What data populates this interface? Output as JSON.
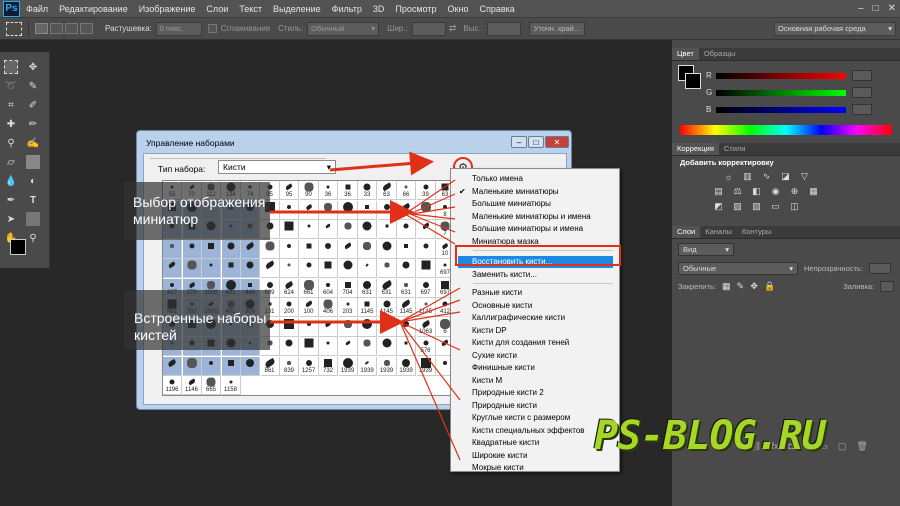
{
  "app": {
    "logo": "Ps",
    "menu": [
      "Файл",
      "Редактирование",
      "Изображение",
      "Слои",
      "Текст",
      "Выделение",
      "Фильтр",
      "3D",
      "Просмотр",
      "Окно",
      "Справка"
    ],
    "window_controls": [
      "–",
      "□",
      "✕"
    ]
  },
  "options_bar": {
    "feather_label": "Растушевка:",
    "feather_value": "0 пикс.",
    "antialias_label": "Сглаживание",
    "style_label": "Стиль:",
    "style_value": "Обычный",
    "width_label": "Шир.:",
    "height_label": "Выс.:",
    "refine_button": "Уточн. край...",
    "workspace": "Основная рабочая среда"
  },
  "color_panel": {
    "tabs": [
      "Цвет",
      "Образцы"
    ],
    "channels": [
      "R",
      "G",
      "B"
    ],
    "channel_values": [
      0,
      0,
      0
    ]
  },
  "adjustments_panel": {
    "tabs": [
      "Коррекция",
      "Стили"
    ],
    "title": "Добавить корректировку"
  },
  "layers_panel": {
    "tabs": [
      "Слои",
      "Каналы",
      "Контуры"
    ],
    "kind_label": "Вид",
    "blend_mode": "Обычные",
    "opacity_label": "Непрозрачность:",
    "lock_label": "Закрепить:",
    "fill_label": "Заливка:"
  },
  "dialog": {
    "title": "Управление наборами",
    "preset_type_label": "Тип набора:",
    "preset_type_value": "Кисти",
    "gear_icon": "⚙",
    "brush_numbers": [
      [
        "55",
        "70",
        "112",
        "134",
        "74",
        "95",
        "95",
        "90",
        "36",
        "36",
        "33",
        "63",
        "66",
        "39",
        "63"
      ],
      [
        "",
        "",
        "",
        "",
        "",
        "",
        "",
        "",
        "",
        "",
        "",
        "",
        "",
        "",
        "8"
      ],
      [
        "",
        "",
        "",
        "",
        "",
        "",
        "",
        "",
        "",
        "",
        "",
        "",
        "",
        "",
        "7"
      ],
      [
        "",
        "",
        "",
        "",
        "",
        "",
        "",
        "",
        "",
        "",
        "",
        "",
        "",
        "",
        "10"
      ],
      [
        "",
        "",
        "",
        "",
        "",
        "",
        "",
        "",
        "",
        "",
        "",
        "",
        "",
        "",
        "697"
      ],
      [
        "427",
        "279",
        "1000",
        "401",
        "448",
        "689",
        "624",
        "661",
        "604",
        "704",
        "631",
        "631",
        "631",
        "697",
        "697"
      ],
      [
        "491",
        "792",
        "1000",
        "401",
        "300",
        "131",
        "200",
        "100",
        "406",
        "203",
        "1145",
        "1145",
        "1145",
        "1145",
        "412"
      ],
      [
        "",
        "",
        "",
        "",
        "",
        "",
        "",
        "",
        "",
        "",
        "",
        "",
        "",
        "1063",
        "6"
      ],
      [
        "",
        "",
        "",
        "",
        "",
        "",
        "",
        "",
        "",
        "",
        "",
        "",
        "",
        "576",
        ""
      ],
      [
        "",
        "",
        "",
        "",
        "",
        "861",
        "839",
        "1257",
        "732",
        "1939",
        "1939",
        "1939",
        "1939",
        "1939",
        ""
      ],
      [
        "1196",
        "1146",
        "665",
        "1158",
        "",
        "",
        "",
        "",
        "",
        "",
        "",
        "",
        "",
        "",
        ""
      ]
    ],
    "partial_row_top": [
      "",
      "",
      "",
      "",
      "",
      "",
      "",
      "",
      "",
      "",
      "",
      "",
      "",
      "",
      ""
    ]
  },
  "flyout_menu": {
    "view_items": [
      "Только имена",
      "Маленькие миниатюры",
      "Большие миниатюры",
      "Маленькие миниатюры и имена",
      "Большие миниатюры и имена",
      "Миниатюра мазка"
    ],
    "checked_index": 1,
    "action_items": [
      "Восстановить кисти...",
      "Заменить кисти..."
    ],
    "highlighted": "Восстановить кисти...",
    "library_items": [
      "Разные кисти",
      "Основные кисти",
      "Каллиграфические кисти",
      "Кисти DP",
      "Кисти для создания теней",
      "Сухие кисти",
      "Финишные кисти",
      "Кисти М",
      "Природные кисти 2",
      "Природные кисти",
      "Круглые кисти с размером",
      "Кисти специальных эффектов",
      "Квадратные кисти",
      "Широкие кисти",
      "Мокрые кисти"
    ]
  },
  "annotations": {
    "thumbnail_choice": [
      "Выбор отображения",
      "миниатюр"
    ],
    "builtin_sets": [
      "Встроенные наборы",
      "кистей"
    ]
  },
  "watermark": "PS-BLOG.RU",
  "colors": {
    "accent_red": "#e03018",
    "highlight_blue": "#1e88e5",
    "logo_green": "#a6d626"
  }
}
